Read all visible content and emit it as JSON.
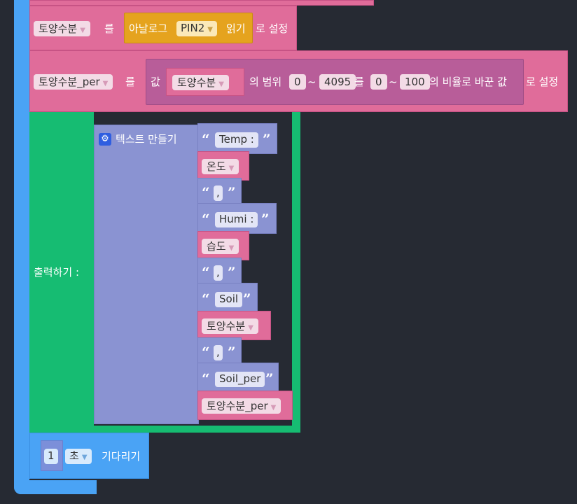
{
  "set_block_1": {
    "variable": "토양수분",
    "to_word": "를",
    "analog_label": "아날로그",
    "pin": "PIN2",
    "read_label": "읽기",
    "set_label": "로 설정"
  },
  "set_block_2": {
    "variable": "토양수분_per",
    "to_word": "를",
    "value_label": "값",
    "source_variable": "토양수분",
    "range_word": "의 범위",
    "from_low": "0",
    "tilde_1": "~",
    "from_high": "4095",
    "to_word_2": "를",
    "to_low": "0",
    "tilde_2": "~",
    "to_high": "100",
    "ratio_label": "의 비율로 바꾼 값",
    "set_label": "로 설정"
  },
  "print_block": {
    "label": "출력하기 :",
    "join_label": "텍스트 만들기",
    "items": [
      {
        "kind": "text",
        "value": "Temp :"
      },
      {
        "kind": "var",
        "value": "온도"
      },
      {
        "kind": "text",
        "value": ","
      },
      {
        "kind": "text",
        "value": "Humi :"
      },
      {
        "kind": "var",
        "value": "습도"
      },
      {
        "kind": "text",
        "value": ","
      },
      {
        "kind": "text",
        "value": "Soil"
      },
      {
        "kind": "var",
        "value": "토양수분"
      },
      {
        "kind": "text",
        "value": ","
      },
      {
        "kind": "text",
        "value": "Soil_per"
      },
      {
        "kind": "var",
        "value": "토양수분_per"
      }
    ]
  },
  "wait_block": {
    "amount": "1",
    "unit": "초",
    "label": "기다리기"
  },
  "colors": {
    "background": "#262a33",
    "variable_block": "#e06c9a",
    "text_block": "#8a93d2",
    "print_block": "#16bc72",
    "loop_block": "#4aa3f5",
    "analog_block": "#e5a31e"
  }
}
